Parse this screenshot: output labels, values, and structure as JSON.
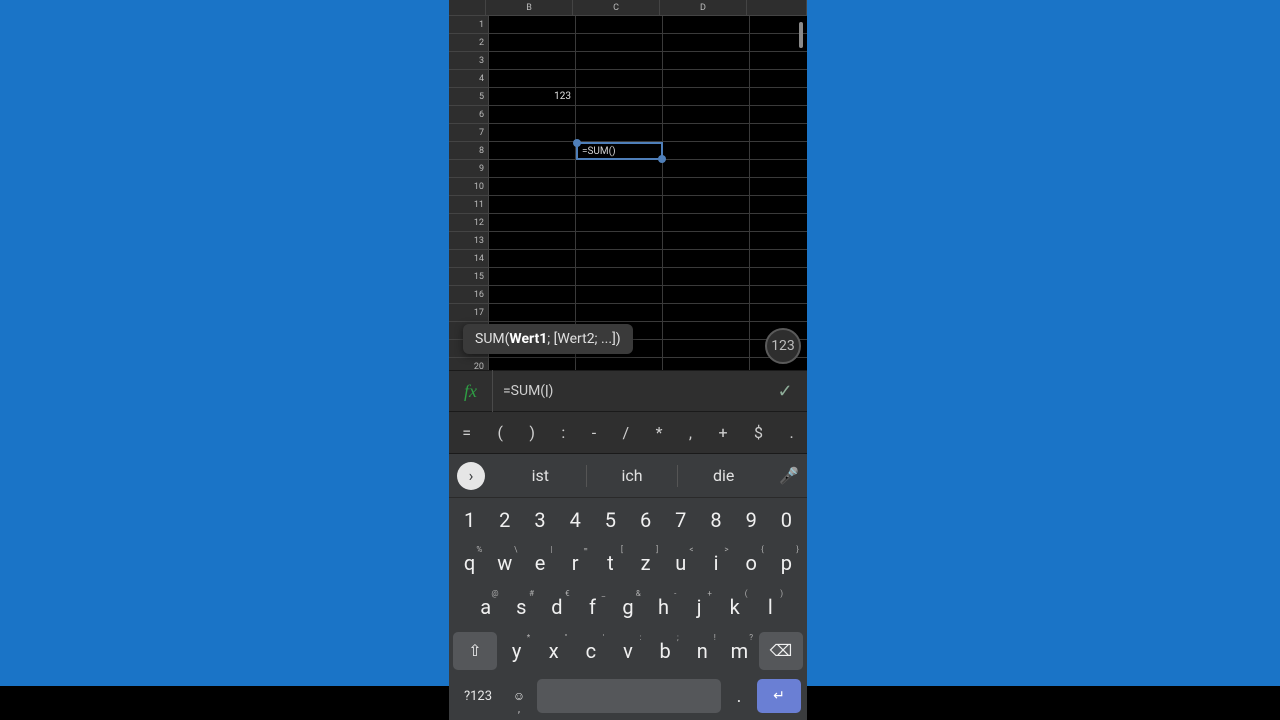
{
  "sheet": {
    "columns": [
      "B",
      "C",
      "D"
    ],
    "row_count_visible": 20,
    "active_cell": {
      "col": "C",
      "row": 8,
      "content": "=SUM()"
    },
    "cells": {
      "B5": "123"
    }
  },
  "tooltip": {
    "fn": "SUM(",
    "arg_active": "Wert1",
    "rest": "; [Wert2; ...])"
  },
  "mode_pill": "123",
  "formula_bar": {
    "icon_label": "fx",
    "value_prefix": "=SUM(",
    "value_suffix": ")",
    "confirm_glyph": "✓"
  },
  "symbol_row": [
    "=",
    "(",
    ")",
    ":",
    "-",
    "/",
    "*",
    ",",
    "+",
    "$",
    "."
  ],
  "keyboard": {
    "expand_glyph": "›",
    "suggestions": [
      "ist",
      "ich",
      "die"
    ],
    "mic_glyph": "🎤",
    "num_row": [
      "1",
      "2",
      "3",
      "4",
      "5",
      "6",
      "7",
      "8",
      "9",
      "0"
    ],
    "row1": [
      {
        "k": "q",
        "h": "%"
      },
      {
        "k": "w",
        "h": "\\"
      },
      {
        "k": "e",
        "h": "|"
      },
      {
        "k": "r",
        "h": "="
      },
      {
        "k": "t",
        "h": "["
      },
      {
        "k": "z",
        "h": "]"
      },
      {
        "k": "u",
        "h": "<"
      },
      {
        "k": "i",
        "h": ">"
      },
      {
        "k": "o",
        "h": "{"
      },
      {
        "k": "p",
        "h": "}"
      }
    ],
    "row2": [
      {
        "k": "a",
        "h": "@"
      },
      {
        "k": "s",
        "h": "#"
      },
      {
        "k": "d",
        "h": "€"
      },
      {
        "k": "f",
        "h": "_"
      },
      {
        "k": "g",
        "h": "&"
      },
      {
        "k": "h",
        "h": "-"
      },
      {
        "k": "j",
        "h": "+"
      },
      {
        "k": "k",
        "h": "("
      },
      {
        "k": "l",
        "h": ")"
      }
    ],
    "row3": {
      "shift_glyph": "⇧",
      "keys": [
        {
          "k": "y",
          "h": "*"
        },
        {
          "k": "x",
          "h": "\""
        },
        {
          "k": "c",
          "h": "'"
        },
        {
          "k": "v",
          "h": ":"
        },
        {
          "k": "b",
          "h": ";"
        },
        {
          "k": "n",
          "h": "!"
        },
        {
          "k": "m",
          "h": "?"
        }
      ],
      "backspace_glyph": "⌫"
    },
    "bottom": {
      "sym": "?123",
      "emoji_glyph": "☺",
      "dot": ".",
      "enter_glyph": "↵"
    }
  }
}
